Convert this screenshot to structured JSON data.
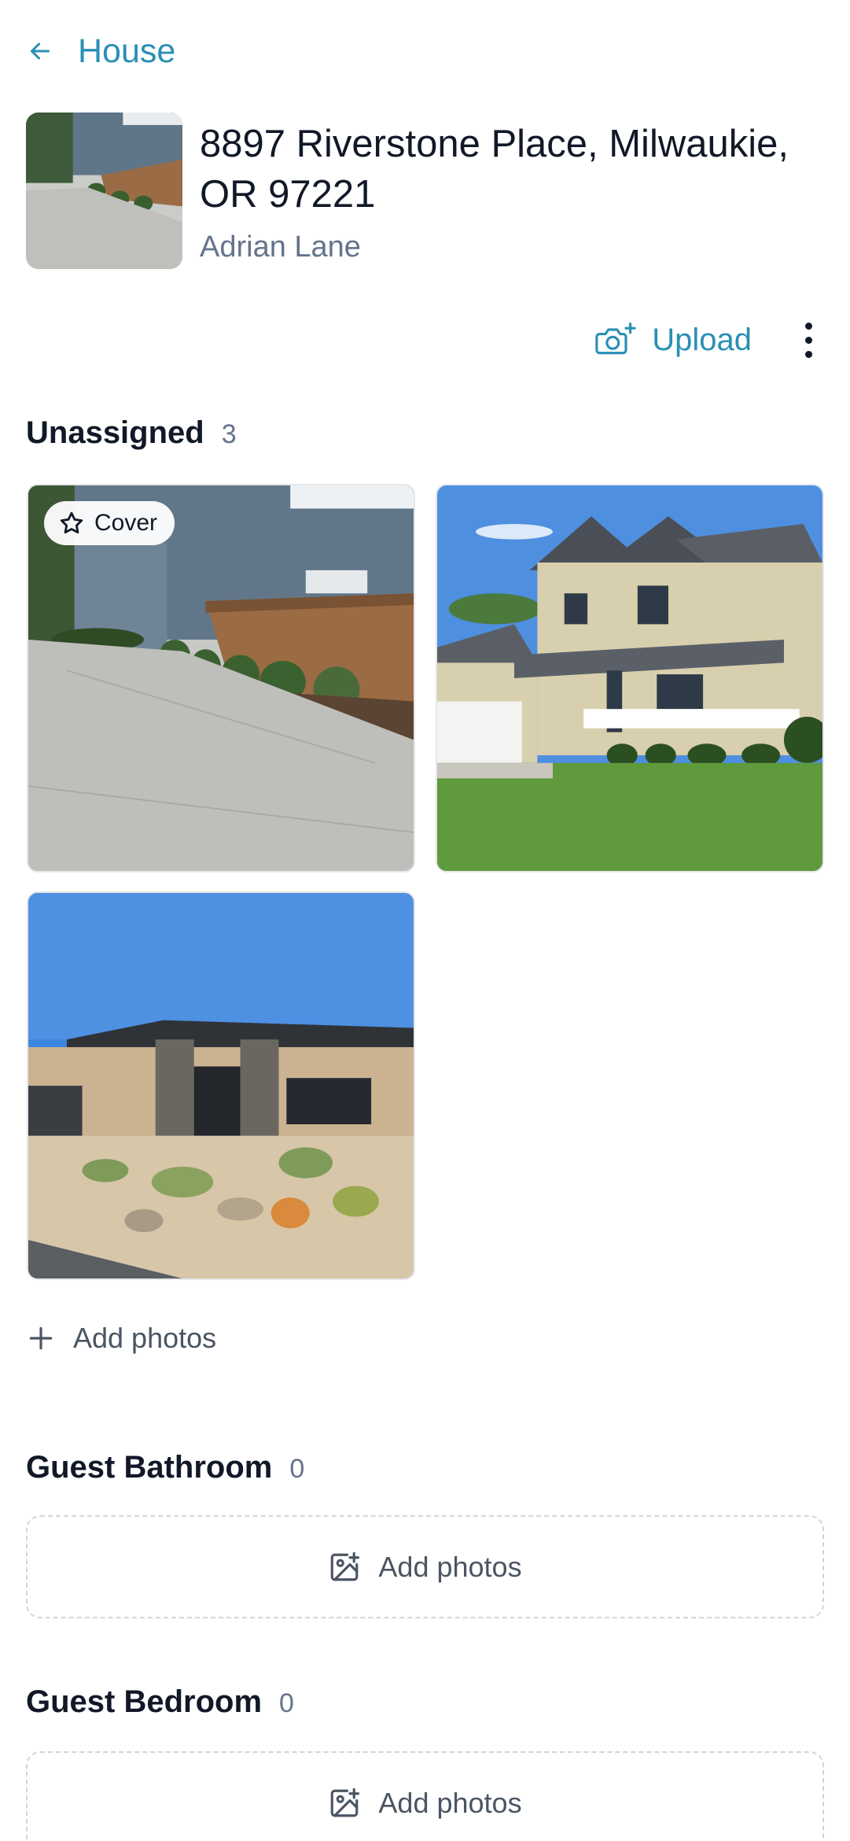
{
  "nav": {
    "back_icon": "arrow-left-icon",
    "title": "House"
  },
  "property": {
    "address": "8897 Riverstone Place, Milwaukie, OR 97221",
    "owner": "Adrian Lane"
  },
  "toolbar": {
    "upload_label": "Upload",
    "upload_icon": "camera-plus-icon",
    "more_icon": "more-vertical-icon"
  },
  "sections": [
    {
      "name": "Unassigned",
      "count": "3",
      "cover_badge": "Cover",
      "add_label": "Add photos"
    },
    {
      "name": "Guest Bathroom",
      "count": "0",
      "add_label": "Add photos"
    },
    {
      "name": "Guest Bedroom",
      "count": "0",
      "add_label": "Add photos"
    }
  ],
  "colors": {
    "accent": "#2a8fb5",
    "text": "#111827",
    "muted": "#64748b"
  }
}
